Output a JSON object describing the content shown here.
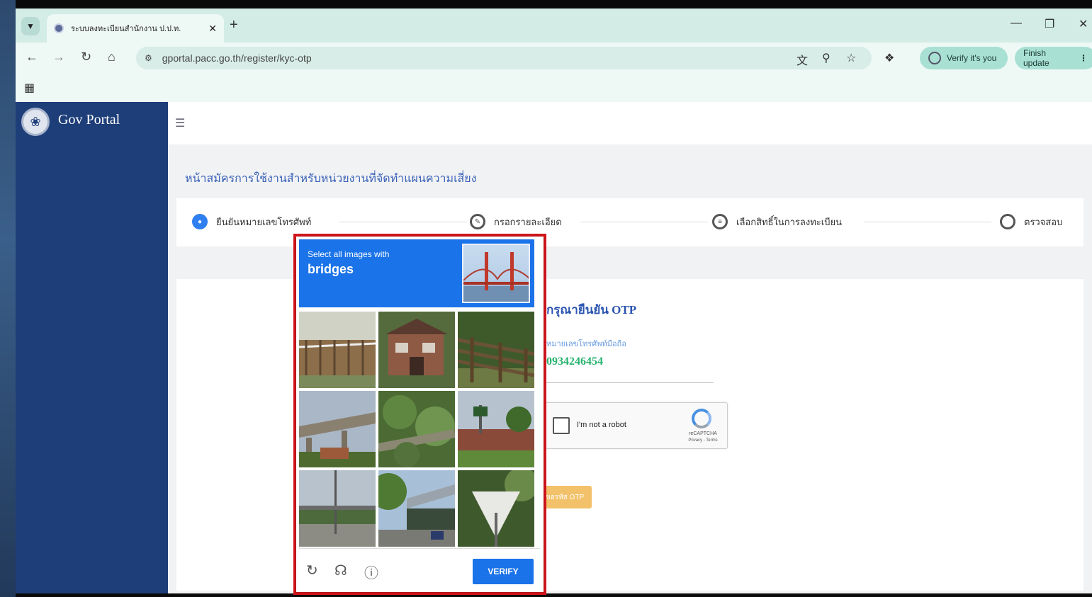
{
  "browser": {
    "tab_title": "ระบบลงทะเบียนสำนักงาน ป.ป.ท.",
    "tab_close": "✕",
    "new_tab": "+",
    "url": "gportal.pacc.go.th/register/kyc-otp",
    "verify_pill": "Verify it's you",
    "update_pill": "Finish update",
    "icons": [
      "tab-search-icon",
      "back-icon",
      "forward-icon",
      "reload-icon",
      "home-icon",
      "site-info-icon",
      "translate-icon",
      "zoom-icon",
      "bookmark-star-icon",
      "extensions-icon",
      "apps-icon",
      "minimize-icon",
      "restore-icon",
      "close-icon"
    ]
  },
  "sidebar": {
    "brand": "Gov Portal"
  },
  "page": {
    "heading": "หน้าสมัครการใช้งานสำหรับหน่วยงานที่จัดทำแผนความเสี่ยง",
    "steps": [
      {
        "label": "ยืนยันหมายเลขโทรศัพท์",
        "active": true
      },
      {
        "label": "กรอกรายละเอียด",
        "active": false
      },
      {
        "label": "เลือกสิทธิ์ในการลงทะเบียน",
        "active": false
      },
      {
        "label": "ตรวจสอบ",
        "active": false
      }
    ],
    "otp_title": "กรุณายืนยัน OTP",
    "phone_label": "หมายเลขโทรศัพท์มือถือ",
    "phone_value": "0934246454",
    "recaptcha_label": "I'm not a robot",
    "recaptcha_brand": "reCAPTCHA",
    "recaptcha_terms": "Privacy - Terms",
    "otp_button": "ขอรหัส OTP"
  },
  "captcha": {
    "prompt": "Select all images with",
    "target": "bridges",
    "verify_label": "VERIFY",
    "footer_icons": [
      "reload-icon",
      "audio-headphones-icon",
      "info-icon"
    ],
    "accent_color": "#1a73e8",
    "highlight_color": "#d5161c"
  }
}
